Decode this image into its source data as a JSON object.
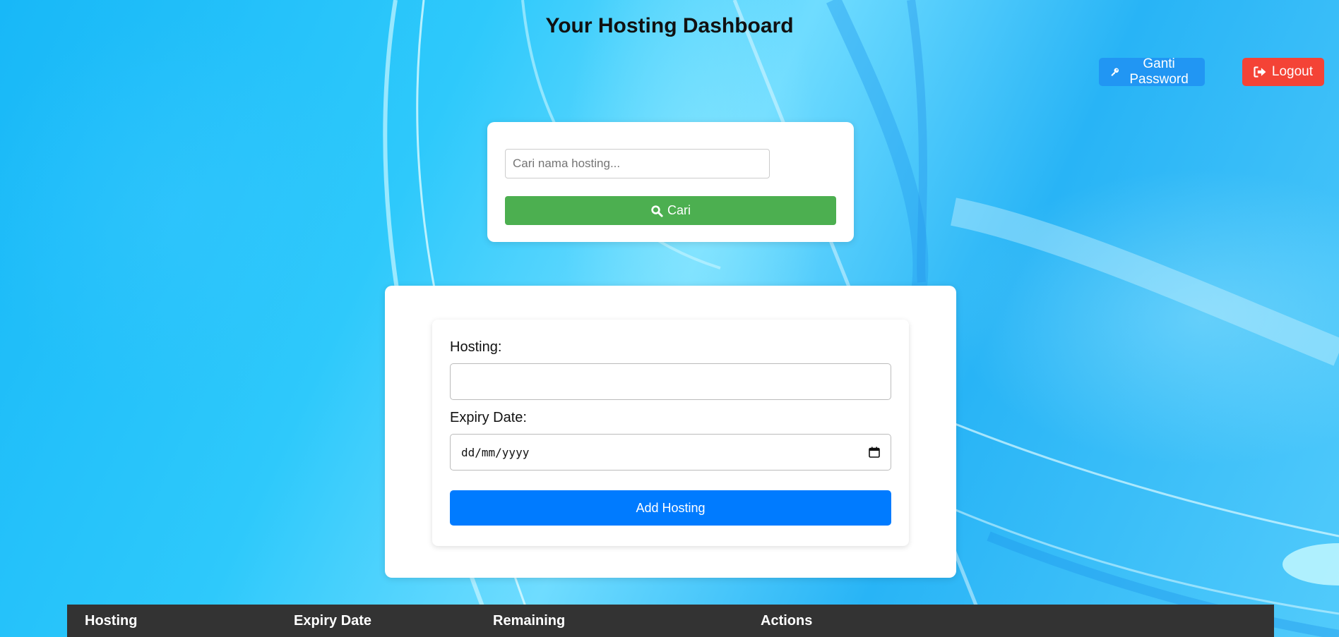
{
  "page": {
    "title": "Your Hosting Dashboard"
  },
  "header": {
    "change_password_label": "Ganti Password",
    "change_password_icon": "key-icon",
    "change_password_color": "#2196f3",
    "logout_label": "Logout",
    "logout_icon": "sign-out-icon",
    "logout_color": "#f44336"
  },
  "search": {
    "placeholder": "Cari nama hosting...",
    "value": "",
    "button_label": "Cari",
    "button_icon": "search-icon",
    "button_color": "#4caf50"
  },
  "form": {
    "hosting_label": "Hosting:",
    "hosting_value": "",
    "expiry_label": "Expiry Date:",
    "expiry_placeholder": "dd/mm/yyyy",
    "expiry_icon": "calendar-icon",
    "submit_label": "Add Hosting",
    "submit_color": "#007bff"
  },
  "table": {
    "header_color": "#333333",
    "columns": [
      "Hosting",
      "Expiry Date",
      "Remaining",
      "Actions"
    ],
    "rows": []
  }
}
